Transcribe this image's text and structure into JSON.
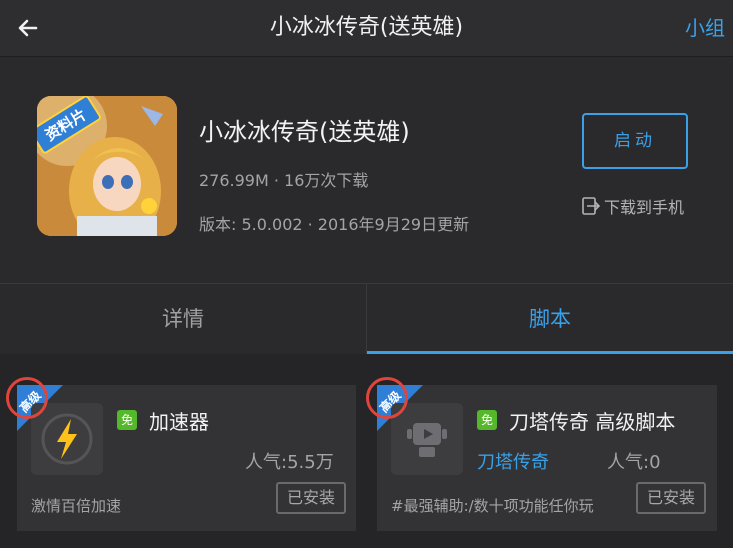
{
  "topbar": {
    "title": "小冰冰传奇(送英雄)",
    "group_link": "小组"
  },
  "app": {
    "name": "小冰冰传奇(送英雄)",
    "size_downloads": "276.99M · 16万次下载",
    "version_line": "版本: 5.0.002 · 2016年9月29日更新",
    "launch_label": "启动",
    "download_to_phone": "下载到手机",
    "icon_badge": "资料片"
  },
  "tabs": [
    {
      "label": "详情",
      "active": false
    },
    {
      "label": "脚本",
      "active": true
    }
  ],
  "scripts": [
    {
      "ribbon": "高级",
      "icon": "lightning-icon",
      "free_badge": "免",
      "name": "加速器",
      "game": "",
      "popularity": "人气:5.5万",
      "description": "激情百倍加速",
      "status": "已安装"
    },
    {
      "ribbon": "高级",
      "icon": "robot-tv-icon",
      "free_badge": "免",
      "name": "刀塔传奇 高级脚本",
      "game": "刀塔传奇",
      "popularity": "人气:0",
      "description": "#最强辅助:/数十项功能任你玩",
      "status": "已安装"
    }
  ],
  "colors": {
    "accent": "#3aa0e8",
    "background": "#2a2a2c",
    "card": "#333335",
    "free_badge": "#55b82a",
    "ribbon": "#2f7fd6",
    "highlight_circle": "#e0453c"
  }
}
